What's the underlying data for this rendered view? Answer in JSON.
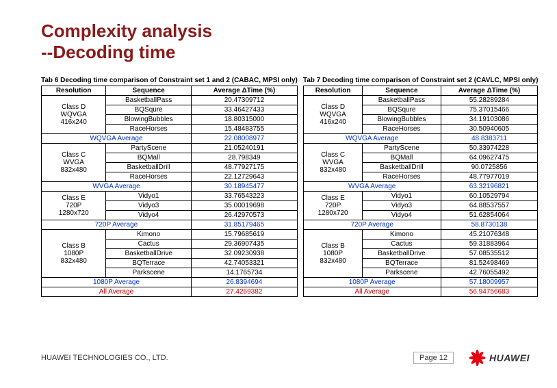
{
  "title_line1": "Complexity analysis",
  "title_line2": "--Decoding time",
  "tables": [
    {
      "caption": "Tab 6 Decoding time comparison of Constraint set 1 and 2 (CABAC, MPSI only)",
      "headers": [
        "Resolution",
        "Sequence",
        "Average ΔTime (%)"
      ],
      "groups": [
        {
          "res": [
            "Class D",
            "WQVGA",
            "416x240"
          ],
          "rows": [
            [
              "BasketballPass",
              "20.47309712"
            ],
            [
              "BQSqure",
              "33.46427433"
            ],
            [
              "BlowingBubbles",
              "18.80315000"
            ],
            [
              "RaceHorses",
              "15.48483755"
            ]
          ],
          "avg": [
            "WQVGA Average",
            "22.08008977"
          ]
        },
        {
          "res": [
            "Class C",
            "WVGA",
            "832x480"
          ],
          "rows": [
            [
              "PartyScene",
              "21.05240191"
            ],
            [
              "BQMall",
              "28.798349"
            ],
            [
              "BasketballDrill",
              "48.77927175"
            ],
            [
              "RaceHorses",
              "22.12729643"
            ]
          ],
          "avg": [
            "WVGA Average",
            "30.18945477"
          ]
        },
        {
          "res": [
            "Class E",
            "720P",
            "1280x720"
          ],
          "rows": [
            [
              "Vidyo1",
              "33.76543223"
            ],
            [
              "Vidyo3",
              "35.00019698"
            ],
            [
              "Vidyo4",
              "26.42970573"
            ]
          ],
          "avg": [
            "720P Average",
            "31.85179465"
          ]
        },
        {
          "res": [
            "Class B",
            "1080P",
            "832x480"
          ],
          "rows": [
            [
              "Kimono",
              "15.79685619"
            ],
            [
              "Cactus",
              "29.36907435"
            ],
            [
              "BasketballDrive",
              "32.09230938"
            ],
            [
              "BQTerrace",
              "42.74053321"
            ],
            [
              "Parkscene",
              "14.1765734"
            ]
          ],
          "avg": [
            "1080P Average",
            "26.8394694"
          ]
        }
      ],
      "all": [
        "All Average",
        "27.4269382"
      ]
    },
    {
      "caption": "Tab 7 Decoding time comparison of Constraint set 2 (CAVLC, MPSI only)",
      "headers": [
        "Resolution",
        "Sequence",
        "Average ΔTime (%)"
      ],
      "groups": [
        {
          "res": [
            "Class D",
            "WQVGA",
            "416x240"
          ],
          "rows": [
            [
              "BasketballPass",
              "55.28289284"
            ],
            [
              "BQSqure",
              "75.37015466"
            ],
            [
              "BlowingBubbles",
              "34.19103086"
            ],
            [
              "RaceHorses",
              "30.50940605"
            ]
          ],
          "avg": [
            "WQVGA Average",
            "48.8383711"
          ]
        },
        {
          "res": [
            "Class C",
            "WVGA",
            "832x480"
          ],
          "rows": [
            [
              "PartyScene",
              "50.33974228"
            ],
            [
              "BQMall",
              "64.09627475"
            ],
            [
              "BasketballDrill",
              "90.0725856"
            ],
            [
              "RaceHorses",
              "48.77977019"
            ]
          ],
          "avg": [
            "WVGA Average",
            "63.32196821"
          ]
        },
        {
          "res": [
            "Class E",
            "720P",
            "1280x720"
          ],
          "rows": [
            [
              "Vidyo1",
              "60.10529794"
            ],
            [
              "Vidyo3",
              "64.88537557"
            ],
            [
              "Vidyo4",
              "51.62854064"
            ]
          ],
          "avg": [
            "720P Average",
            "58.8730138"
          ]
        },
        {
          "res": [
            "Class B",
            "1080P",
            "832x480"
          ],
          "rows": [
            [
              "Kimono",
              "45.21076348"
            ],
            [
              "Cactus",
              "59.31883964"
            ],
            [
              "BasketballDrive",
              "57.08535512"
            ],
            [
              "BQTerrace",
              "81.52498469"
            ],
            [
              "Parkscene",
              "42.76055492"
            ]
          ],
          "avg": [
            "1080P Average",
            "57.18009957"
          ]
        }
      ],
      "all": [
        "All Average",
        "56.94756683"
      ]
    }
  ],
  "footer": {
    "company": "HUAWEI TECHNOLOGIES CO., LTD.",
    "page": "Page 12",
    "brand": "HUAWEI"
  }
}
